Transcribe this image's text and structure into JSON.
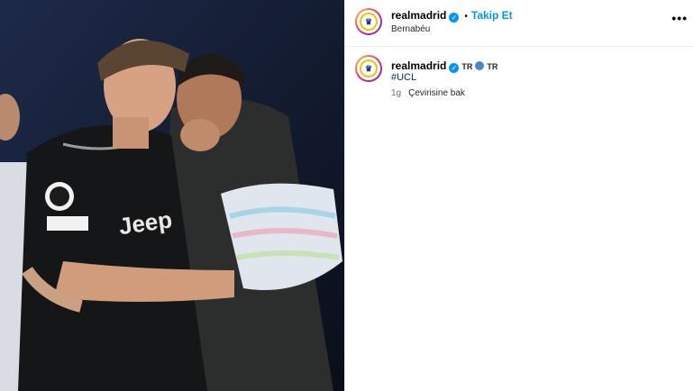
{
  "header": {
    "username": "realmadrid",
    "separator": "•",
    "follow_label": "Takip Et",
    "location": "Bernabéu",
    "more_label": "•••"
  },
  "caption": {
    "username": "realmadrid",
    "lang_badge_1": "TR",
    "lang_badge_2": "TR",
    "hashtag": "#UCL",
    "time_ago": "1g",
    "translate_label": "Çevirisine bak"
  },
  "colors": {
    "accent_blue": "#0095f6",
    "verified": "#0095f6",
    "hashtag": "#00376b"
  },
  "icons": [
    "verified-badge-icon",
    "globe-icon",
    "more-options-icon"
  ]
}
